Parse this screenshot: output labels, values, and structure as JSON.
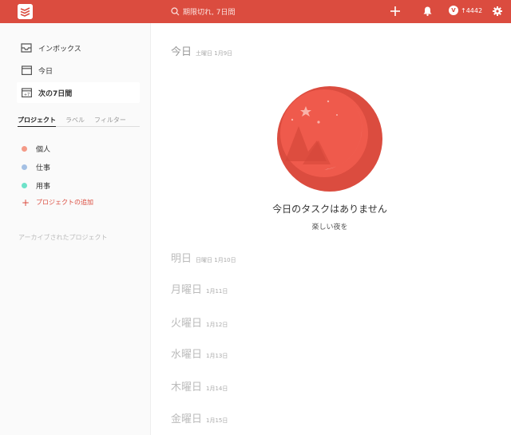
{
  "header": {
    "search_label": "期限切れ, 7日間",
    "karma_value": "↑4442",
    "karma_badge": "V"
  },
  "sidebar": {
    "nav": [
      {
        "label": "インボックス",
        "icon": "inbox-icon"
      },
      {
        "label": "今日",
        "icon": "calendar-icon"
      },
      {
        "label": "次の7日間",
        "icon": "calendar-plus7-icon"
      }
    ],
    "tabs": [
      "プロジェクト",
      "ラベル",
      "フィルター"
    ],
    "projects": [
      {
        "label": "個人",
        "color": "#f49a87"
      },
      {
        "label": "仕事",
        "color": "#a4c0e4"
      },
      {
        "label": "用事",
        "color": "#6de2c9"
      }
    ],
    "add_project_label": "プロジェクトの追加",
    "archived_label": "アーカイブされたプロジェクト"
  },
  "main": {
    "days": [
      {
        "name": "今日",
        "date": "土曜日 1月9日"
      },
      {
        "name": "明日",
        "date": "日曜日 1月10日"
      },
      {
        "name": "月曜日",
        "date": "1月11日"
      },
      {
        "name": "火曜日",
        "date": "1月12日"
      },
      {
        "name": "水曜日",
        "date": "1月13日"
      },
      {
        "name": "木曜日",
        "date": "1月14日"
      },
      {
        "name": "金曜日",
        "date": "1月15日"
      }
    ],
    "empty_title": "今日のタスクはありません",
    "empty_subtitle": "楽しい夜を"
  },
  "colors": {
    "brand": "#db4c3f"
  }
}
